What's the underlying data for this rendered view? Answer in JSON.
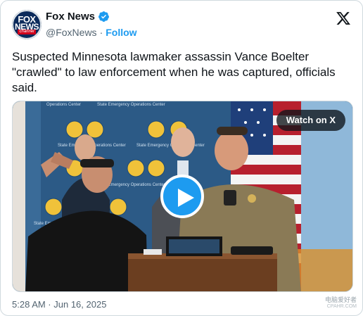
{
  "account": {
    "display_name": "Fox News",
    "handle": "@FoxNews",
    "separator": "·",
    "follow_label": "Follow",
    "avatar_top": "FOX",
    "avatar_bottom": "NEWS",
    "avatar_tag": "channel",
    "verified": true
  },
  "tweet": {
    "text": "Suspected Minnesota lawmaker assassin Vance Boelter \"crawled\" to law enforcement when he was captured, officials said.",
    "timestamp": "5:28 AM · Jun 16, 2025"
  },
  "media": {
    "watch_label": "Watch on X",
    "backdrop_text": "State Emergency Operations Center",
    "backdrop_text_short": "Operations Center"
  },
  "watermark": {
    "main": "电脑爱好者",
    "sub": "CPAHR.COM"
  },
  "colors": {
    "accent": "#1d9bf0",
    "text": "#0f1419",
    "secondary": "#536471",
    "border": "#cfd9de"
  },
  "icons": {
    "verified": "verified-badge-icon",
    "x_logo": "x-logo-icon",
    "play": "play-icon"
  }
}
